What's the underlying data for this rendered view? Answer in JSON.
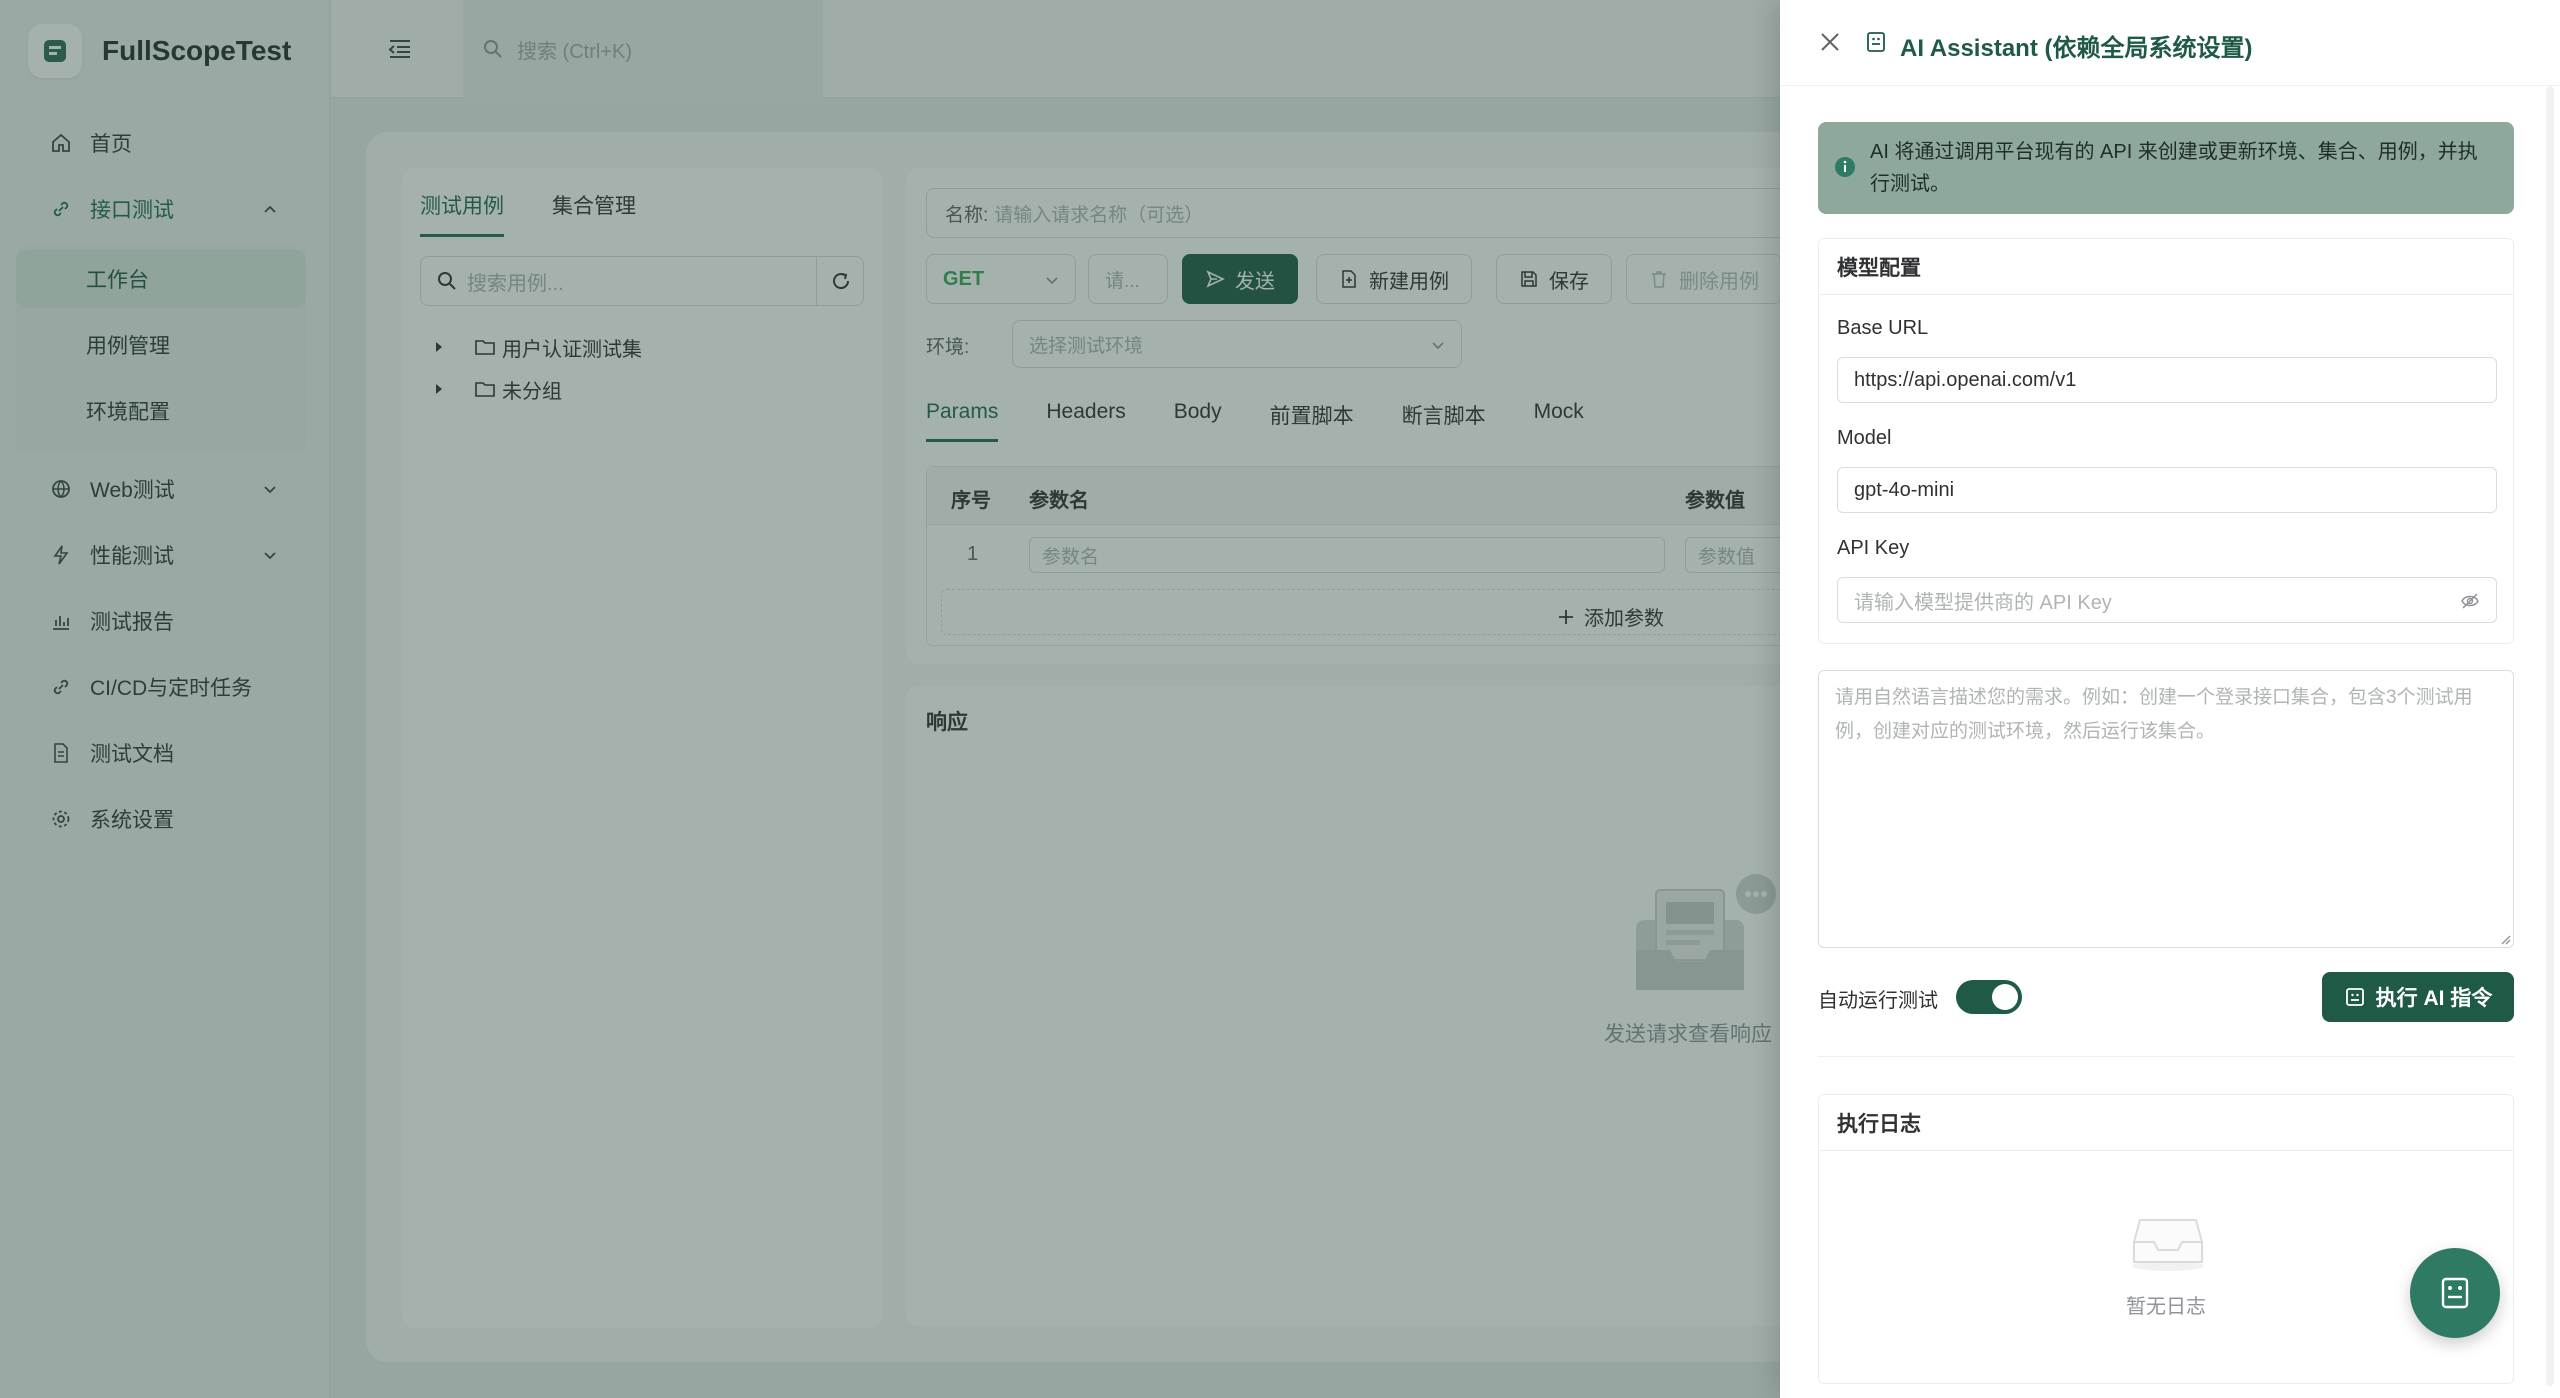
{
  "app": {
    "name": "FullScopeTest"
  },
  "sidebar": {
    "items": [
      {
        "label": "首页"
      },
      {
        "label": "接口测试",
        "children": [
          "工作台",
          "用例管理",
          "环境配置"
        ]
      },
      {
        "label": "Web测试"
      },
      {
        "label": "性能测试"
      },
      {
        "label": "测试报告"
      },
      {
        "label": "CI/CD与定时任务"
      },
      {
        "label": "测试文档"
      },
      {
        "label": "系统设置"
      }
    ]
  },
  "topbar": {
    "search_placeholder": "搜索 (Ctrl+K)"
  },
  "case_panel": {
    "tabs": [
      "测试用例",
      "集合管理"
    ],
    "search_placeholder": "搜索用例...",
    "tree": [
      "用户认证测试集",
      "未分组"
    ]
  },
  "request": {
    "name_label": "名称:",
    "name_placeholder": "请输入请求名称（可选）",
    "method": "GET",
    "url_placeholder": "请...",
    "send_label": "发送",
    "new_case_label": "新建用例",
    "save_label": "保存",
    "delete_label": "删除用例",
    "env_label": "环境:",
    "env_placeholder": "选择测试环境",
    "tabs": [
      "Params",
      "Headers",
      "Body",
      "前置脚本",
      "断言脚本",
      "Mock"
    ],
    "params_table": {
      "headers": [
        "序号",
        "参数名",
        "参数值"
      ],
      "row_index": "1",
      "name_placeholder": "参数名",
      "value_placeholder": "参数值",
      "add_label": "添加参数"
    }
  },
  "response": {
    "title": "响应",
    "empty_text": "发送请求查看响应"
  },
  "drawer": {
    "title": "AI Assistant (依赖全局系统设置)",
    "info": "AI 将通过调用平台现有的 API 来创建或更新环境、集合、用例，并执行测试。",
    "model_config": {
      "title": "模型配置",
      "base_url_label": "Base URL",
      "base_url_value": "https://api.openai.com/v1",
      "model_label": "Model",
      "model_value": "gpt-4o-mini",
      "api_key_label": "API Key",
      "api_key_placeholder": "请输入模型提供商的 API Key"
    },
    "prompt_placeholder": "请用自然语言描述您的需求。例如：创建一个登录接口集合，包含3个测试用例，创建对应的测试环境，然后运行该集合。",
    "auto_run_label": "自动运行测试",
    "auto_run_on": true,
    "run_label": "执行 AI 指令",
    "log_title": "执行日志",
    "log_empty": "暂无日志"
  },
  "colors": {
    "brand": "#1f5a47",
    "accent": "#1f6a52",
    "method_get": "#3aa655"
  }
}
